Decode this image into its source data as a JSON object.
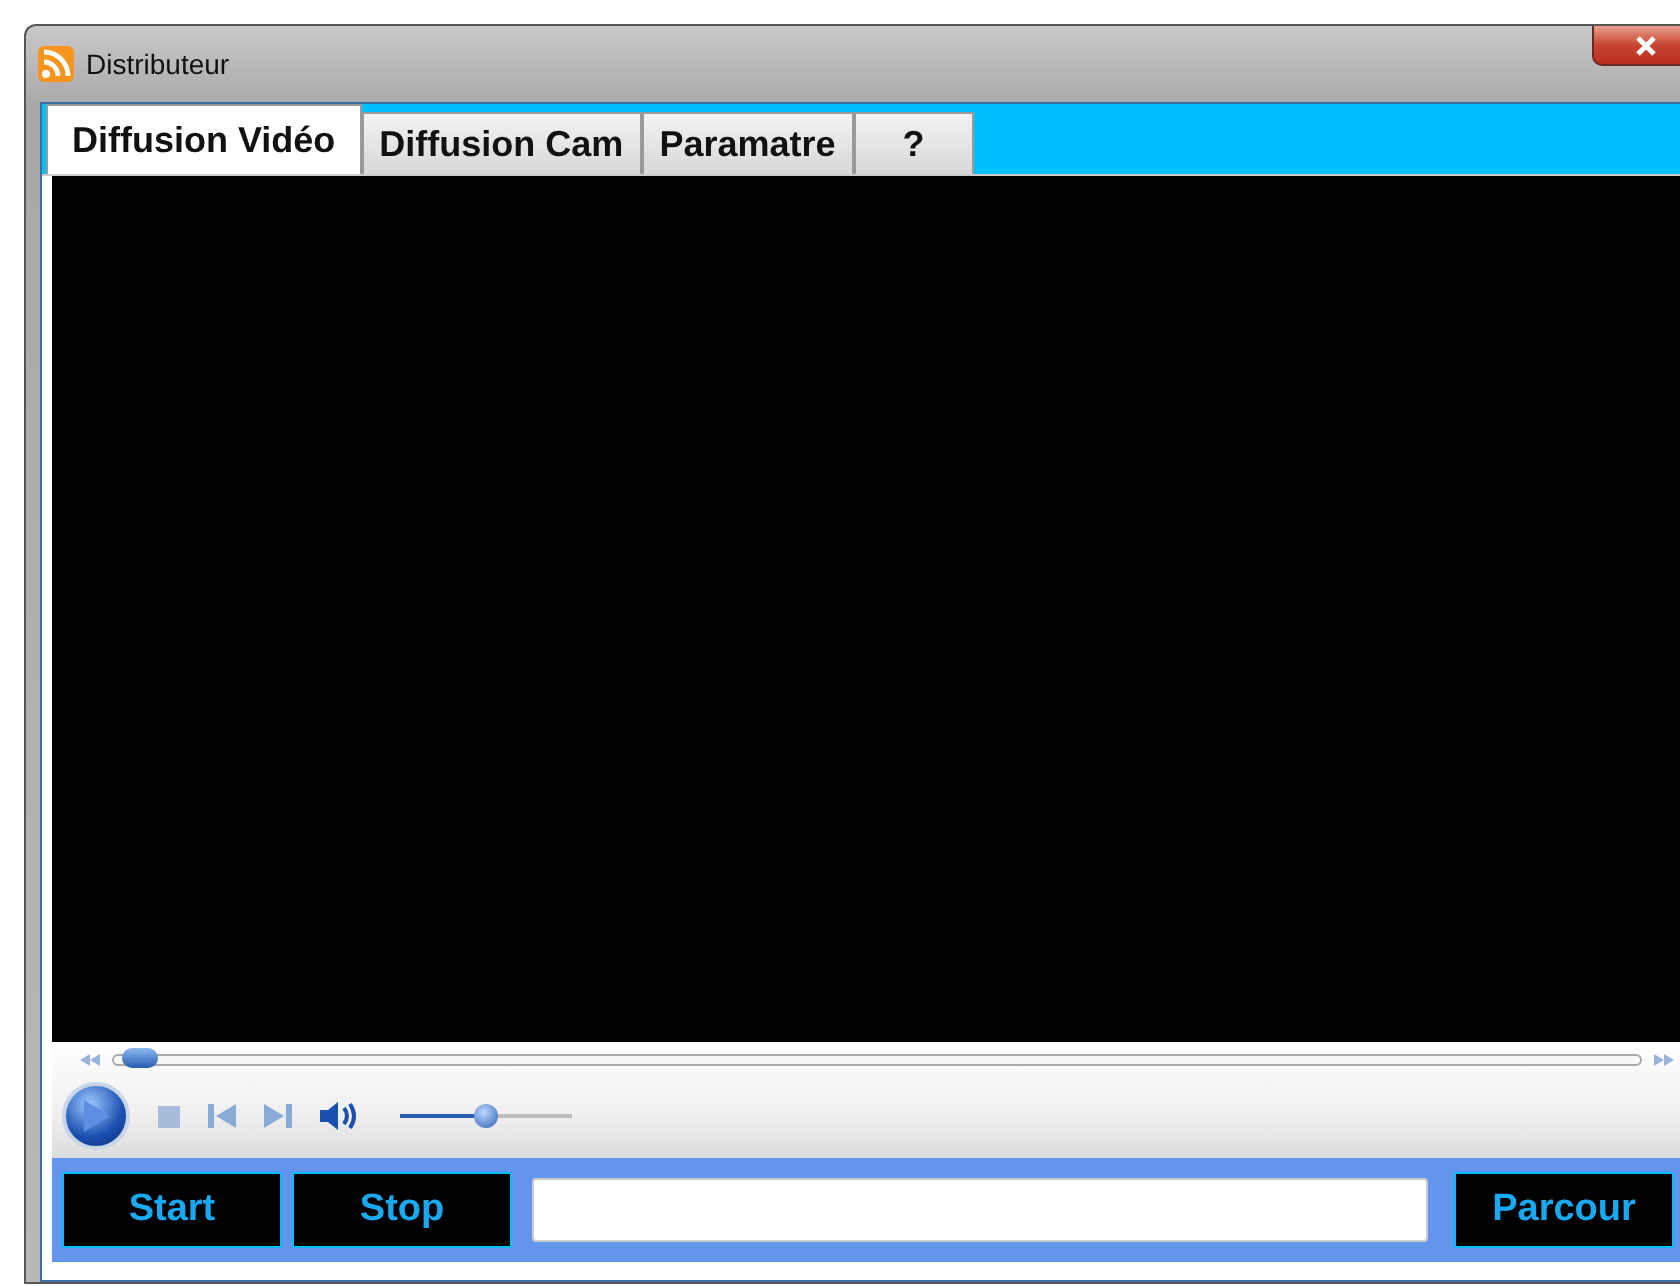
{
  "window": {
    "title": "Distributeur"
  },
  "tabs": [
    {
      "label": "Diffusion  Vidéo",
      "selected": true
    },
    {
      "label": "Diffusion Cam",
      "selected": false
    },
    {
      "label": "Paramatre",
      "selected": false
    },
    {
      "label": "?",
      "selected": false
    }
  ],
  "player": {
    "seek": {
      "level": 0.01
    },
    "volume": {
      "level": 0.5
    }
  },
  "buttons": [
    {
      "label": "Start"
    },
    {
      "label": "Stop"
    }
  ],
  "browse_button": {
    "label": "Parcour"
  }
}
